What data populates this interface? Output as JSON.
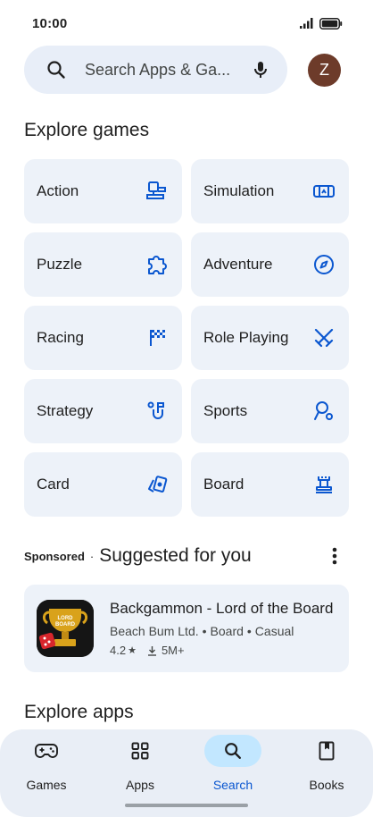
{
  "status_bar": {
    "time": "10:00"
  },
  "search": {
    "placeholder": "Search Apps & Ga..."
  },
  "account": {
    "avatar_letter": "Z"
  },
  "explore_games": {
    "title": "Explore games",
    "categories": [
      {
        "label": "Action",
        "icon": "action-icon"
      },
      {
        "label": "Simulation",
        "icon": "simulation-icon"
      },
      {
        "label": "Puzzle",
        "icon": "puzzle-icon"
      },
      {
        "label": "Adventure",
        "icon": "compass-icon"
      },
      {
        "label": "Racing",
        "icon": "checkered-flag-icon"
      },
      {
        "label": "Role Playing",
        "icon": "crossed-swords-icon"
      },
      {
        "label": "Strategy",
        "icon": "strategy-icon"
      },
      {
        "label": "Sports",
        "icon": "sports-icon"
      },
      {
        "label": "Card",
        "icon": "cards-icon"
      },
      {
        "label": "Board",
        "icon": "chess-rook-icon"
      }
    ]
  },
  "suggested": {
    "sponsored_label": "Sponsored",
    "separator": "·",
    "title": "Suggested for you",
    "app": {
      "name": "Backgammon - Lord of the Board",
      "developer": "Beach Bum Ltd.",
      "tags": [
        "Board",
        "Casual"
      ],
      "rating": "4.2",
      "rating_star": "★",
      "downloads": "5M+",
      "icon_text": [
        "LORD",
        "BOARD"
      ]
    }
  },
  "explore_apps": {
    "title": "Explore apps"
  },
  "bottom_nav": {
    "items": [
      {
        "label": "Games",
        "icon": "gamepad-icon"
      },
      {
        "label": "Apps",
        "icon": "apps-grid-icon"
      },
      {
        "label": "Search",
        "icon": "search-icon",
        "active": true
      },
      {
        "label": "Books",
        "icon": "book-icon"
      }
    ]
  },
  "colors": {
    "accent": "#0b57d0",
    "card_bg": "#edf2f9",
    "search_bg": "#e8eef8",
    "avatar_bg": "#6d3b2a",
    "nav_active_bg": "#c2e7ff"
  }
}
